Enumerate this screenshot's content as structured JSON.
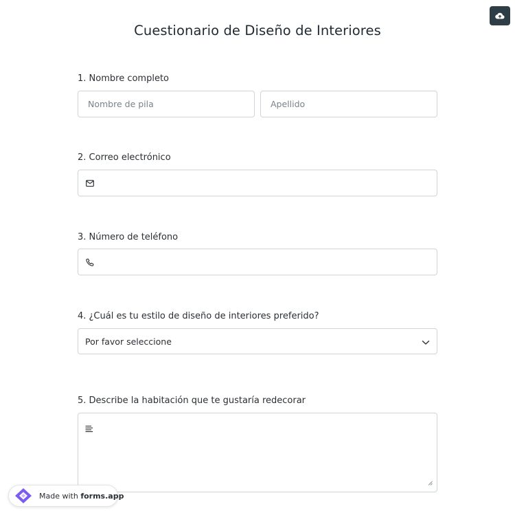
{
  "header": {
    "title": "Cuestionario de Diseño de Interiores",
    "save_icon": "cloud-upload-icon"
  },
  "questions": [
    {
      "label": "1. Nombre completo",
      "first_name_placeholder": "Nombre de pila",
      "last_name_placeholder": "Apellido"
    },
    {
      "label": "2. Correo electrónico",
      "icon": "envelope-icon",
      "value": ""
    },
    {
      "label": "3. Número de teléfono",
      "icon": "phone-icon",
      "value": ""
    },
    {
      "label": "4. ¿Cuál es tu estilo de diseño de interiores preferido?",
      "selected": "Por favor seleccione",
      "icon": "chevron-down-icon"
    },
    {
      "label": "5. Describe la habitación que te gustaría redecorar",
      "icon": "text-lines-icon",
      "value": ""
    }
  ],
  "footer": {
    "badge_prefix": "Made with ",
    "badge_brand": "forms.app"
  },
  "colors": {
    "save_button_bg": "#2f3e46",
    "border": "#cfd4d8",
    "logo_purple": "#7b5cf0"
  }
}
